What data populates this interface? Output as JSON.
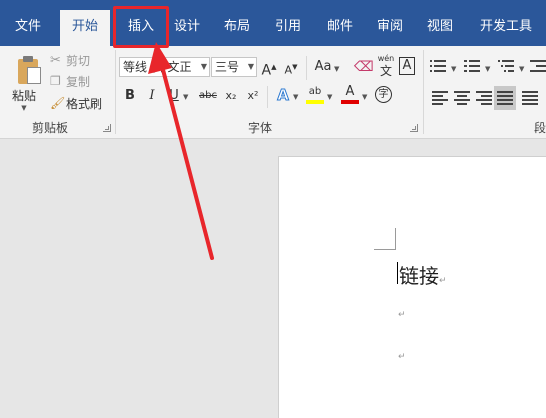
{
  "tabs": [
    {
      "label": "文件",
      "active": false
    },
    {
      "label": "开始",
      "active": true
    },
    {
      "label": "插入",
      "active": false,
      "highlighted": true
    },
    {
      "label": "设计",
      "active": false
    },
    {
      "label": "布局",
      "active": false
    },
    {
      "label": "引用",
      "active": false
    },
    {
      "label": "邮件",
      "active": false
    },
    {
      "label": "审阅",
      "active": false
    },
    {
      "label": "视图",
      "active": false
    },
    {
      "label": "开发工具",
      "active": false
    }
  ],
  "clipboard": {
    "paste_label": "粘贴",
    "cut_label": "剪切",
    "copy_label": "复制",
    "format_painter_label": "格式刷",
    "group_label": "剪贴板"
  },
  "font": {
    "font_name": "等线 (中文正",
    "font_size": "三号",
    "group_label": "字体",
    "grow_label": "A",
    "shrink_label": "A",
    "case_label": "Aa",
    "phonetic_top": "wén",
    "phonetic_bottom": "文",
    "border_label": "A",
    "bold_label": "B",
    "italic_label": "I",
    "underline_label": "U",
    "strike_label": "abc",
    "subscript_label": "x₂",
    "superscript_label": "x²",
    "effects_label": "A",
    "highlight_label": "ab",
    "color_label": "A",
    "enclose_label": "字"
  },
  "paragraph": {
    "group_label": "段"
  },
  "document": {
    "line1": "链接",
    "para_mark": "↵"
  },
  "colors": {
    "ribbon_blue": "#2b579a",
    "highlight_red": "#e8262b",
    "highlight_yellow": "#ffff00",
    "font_color_red": "#e00000"
  }
}
